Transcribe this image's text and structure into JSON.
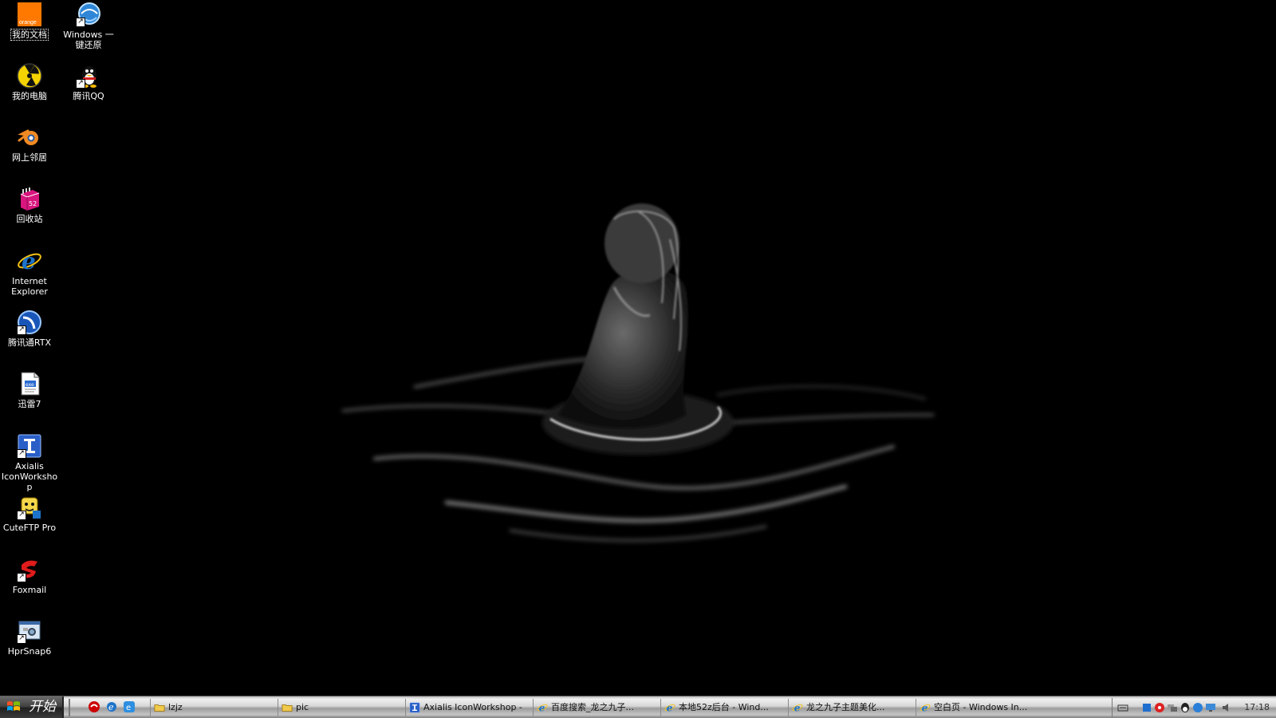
{
  "desktop": {
    "icons": [
      {
        "label": "我的文档",
        "icon": "orange-logo-icon"
      },
      {
        "label": "Windows 一键还原",
        "icon": "restore-globe-icon"
      },
      {
        "label": "我的电脑",
        "icon": "radiation-icon"
      },
      {
        "label": "腾讯QQ",
        "icon": "qq-penguin-icon"
      },
      {
        "label": "网上邻居",
        "icon": "blender-icon"
      },
      {
        "label": "回收站",
        "icon": "recycle-box-icon"
      },
      {
        "label": "Internet Explorer",
        "icon": "ie-icon"
      },
      {
        "label": "腾讯通RTX",
        "icon": "rtx-icon"
      },
      {
        "label": "迅雷7",
        "icon": "thunder-doc-icon"
      },
      {
        "label": "Axialis IconWorkshop",
        "icon": "axialis-icon"
      },
      {
        "label": "CuteFTP Pro",
        "icon": "cuteftp-icon"
      },
      {
        "label": "Foxmail",
        "icon": "foxmail-icon"
      },
      {
        "label": "HprSnap6",
        "icon": "hypersnap-icon"
      }
    ]
  },
  "taskbar": {
    "start_label": "开始",
    "tasks": [
      {
        "label": "lzjz",
        "icon": "folder-icon"
      },
      {
        "label": "pic",
        "icon": "folder-icon"
      },
      {
        "label": "Axialis IconWorkshop -",
        "icon": "axialis-icon"
      },
      {
        "label": "百度搜索_龙之九子...",
        "icon": "ie-icon"
      },
      {
        "label": "本地52z后台 - Wind...",
        "icon": "ie-icon"
      },
      {
        "label": "龙之九子主题美化...",
        "icon": "ie-icon"
      },
      {
        "label": "空白页 - Windows In...",
        "icon": "ie-icon"
      }
    ],
    "clock": "17:18"
  },
  "colors": {
    "desktop_bg": "#000000",
    "icon_label": "#ffffff"
  }
}
